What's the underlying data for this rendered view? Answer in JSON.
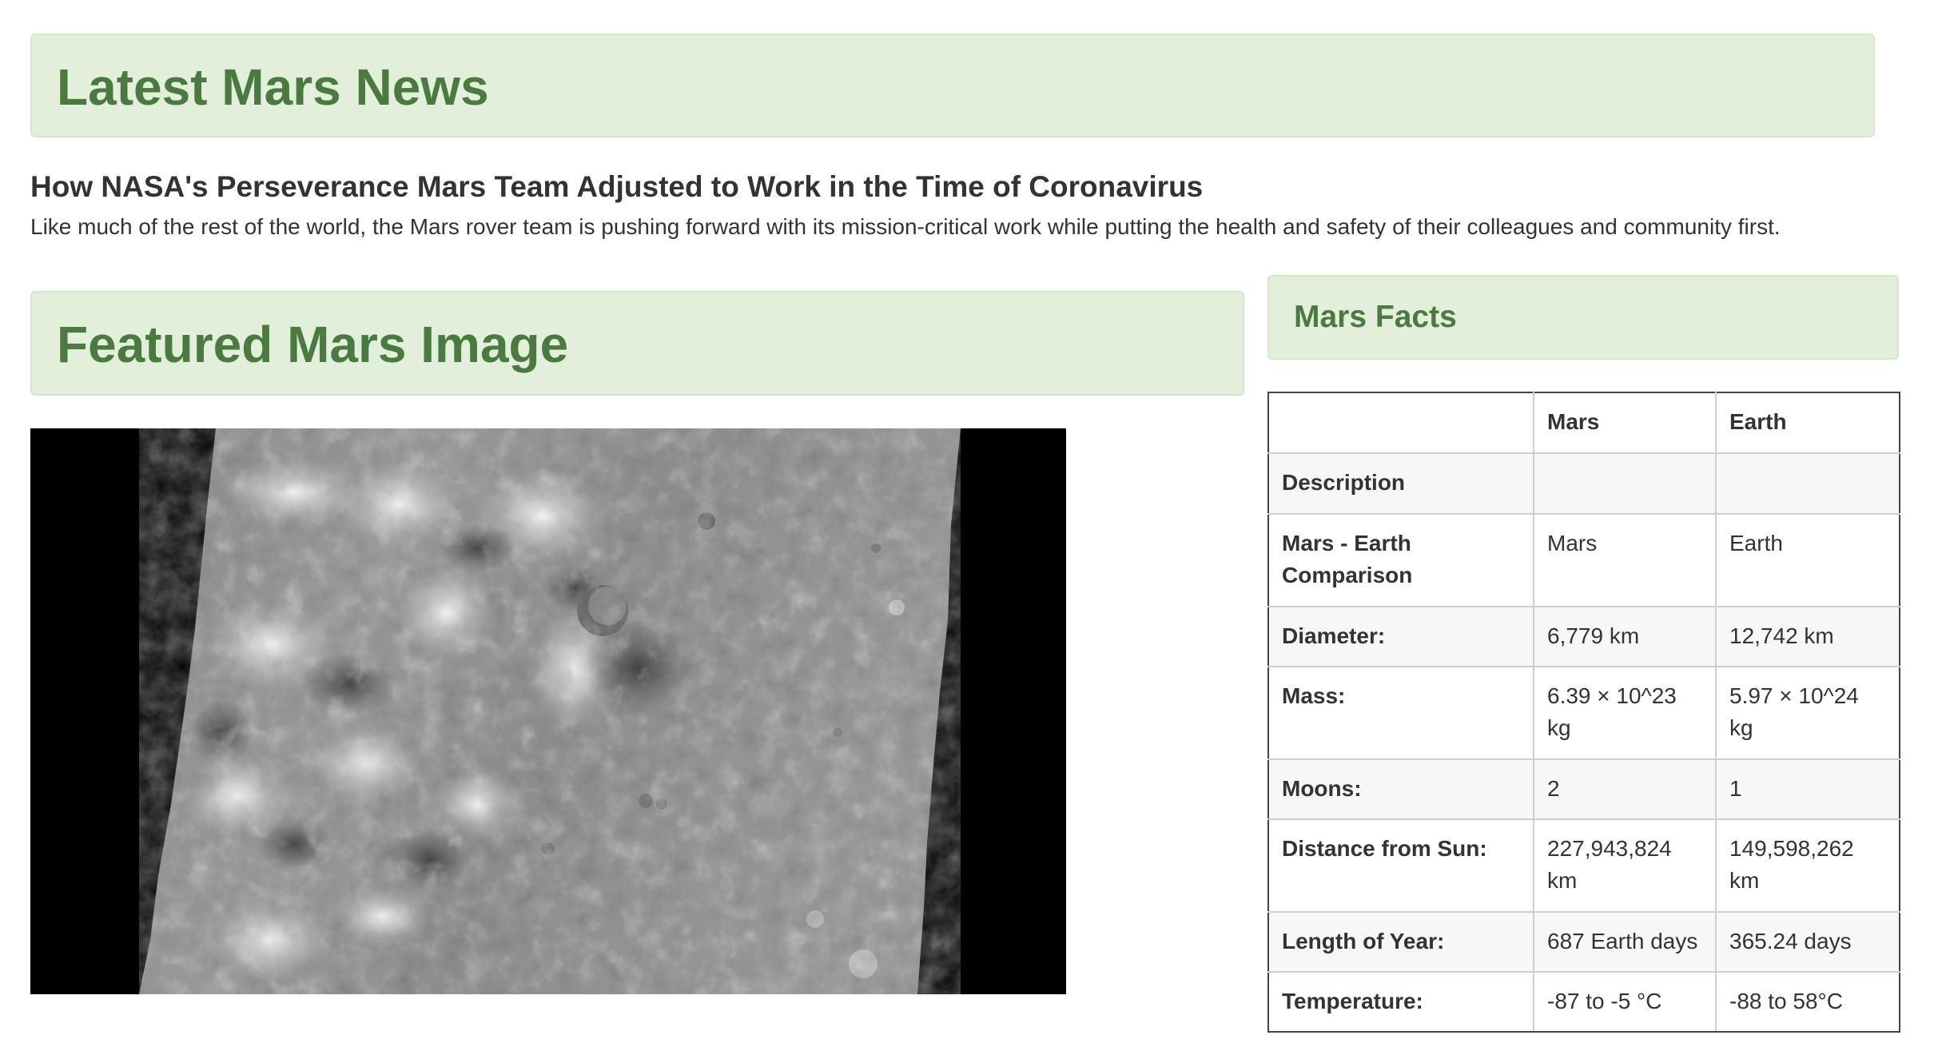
{
  "news": {
    "heading": "Latest Mars News",
    "title": "How NASA's Perseverance Mars Team Adjusted to Work in the Time of Coronavirus",
    "teaser": "Like much of the rest of the world, the Mars rover team is pushing forward with its mission-critical work while putting the health and safety of their colleagues and community first."
  },
  "featured": {
    "heading": "Featured Mars Image"
  },
  "facts": {
    "heading": "Mars Facts",
    "columns": [
      "",
      "Mars",
      "Earth"
    ],
    "rows": [
      {
        "label": "Description",
        "mars": "",
        "earth": ""
      },
      {
        "label": "Mars - Earth Comparison",
        "mars": "Mars",
        "earth": "Earth"
      },
      {
        "label": "Diameter:",
        "mars": "6,779 km",
        "earth": "12,742 km"
      },
      {
        "label": "Mass:",
        "mars": "6.39 × 10^23 kg",
        "earth": "5.97 × 10^24 kg"
      },
      {
        "label": "Moons:",
        "mars": "2",
        "earth": "1"
      },
      {
        "label": "Distance from Sun:",
        "mars": "227,943,824 km",
        "earth": "149,598,262 km"
      },
      {
        "label": "Length of Year:",
        "mars": "687 Earth days",
        "earth": "365.24 days"
      },
      {
        "label": "Temperature:",
        "mars": "-87 to -5 °C",
        "earth": "-88 to 58°C"
      }
    ]
  },
  "colors": {
    "panel_bg": "#e2efda",
    "heading_green": "#4a7a3f"
  }
}
